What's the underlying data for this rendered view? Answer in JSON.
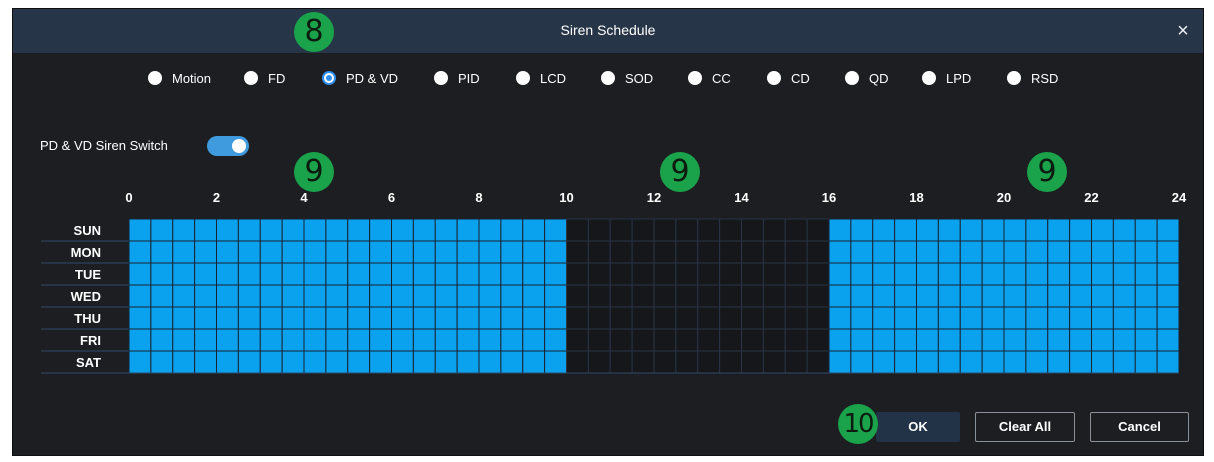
{
  "dialog": {
    "title": "Siren Schedule",
    "close_symbol": "×"
  },
  "detection_types": {
    "options": [
      "Motion",
      "FD",
      "PD & VD",
      "PID",
      "LCD",
      "SOD",
      "CC",
      "CD",
      "QD",
      "LPD",
      "RSD"
    ],
    "selected": "PD & VD"
  },
  "siren_switch": {
    "label": "PD & VD Siren Switch",
    "enabled": true
  },
  "schedule": {
    "hour_labels": [
      "0",
      "2",
      "4",
      "6",
      "8",
      "10",
      "12",
      "14",
      "16",
      "18",
      "20",
      "22",
      "24"
    ],
    "days": [
      "SUN",
      "MON",
      "TUE",
      "WED",
      "THU",
      "FRI",
      "SAT"
    ],
    "slots_per_day": 48,
    "active_ranges_hours": [
      [
        0,
        10
      ],
      [
        16,
        24
      ]
    ],
    "active_color": "#0aa1ee"
  },
  "annotations": {
    "badge_8": "8",
    "badge_9": "9",
    "badge_10": "10"
  },
  "buttons": {
    "ok": "OK",
    "clear_all": "Clear All",
    "cancel": "Cancel"
  },
  "colors": {
    "dialog_bg": "#1c1e22",
    "titlebar_bg": "#273548",
    "accent": "#2d8ff0",
    "annotation_badge": "#1aa34a"
  }
}
